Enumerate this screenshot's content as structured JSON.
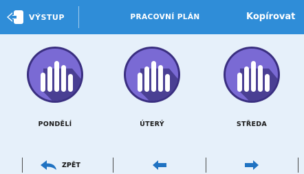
{
  "header": {
    "exit_label": "VÝSTUP",
    "title": "PRACOVNÍ PLÁN",
    "copy_label": "Kopírovat"
  },
  "days": [
    {
      "label": "PONDĚLÍ",
      "icon": "bar-chart-icon"
    },
    {
      "label": "ÚTERÝ",
      "icon": "bar-chart-icon"
    },
    {
      "label": "STŘEDA",
      "icon": "bar-chart-icon"
    }
  ],
  "footer": {
    "back_label": "ZPĚT",
    "prev_icon": "arrow-left-icon",
    "next_icon": "arrow-right-icon"
  },
  "colors": {
    "header_bg": "#2f8dd8",
    "page_bg": "#e6f0fa",
    "circle_fill": "#7a6ad4",
    "circle_shadow": "#4a3f93",
    "circle_ring": "#3a2f80",
    "arrow": "#1f72c2"
  }
}
